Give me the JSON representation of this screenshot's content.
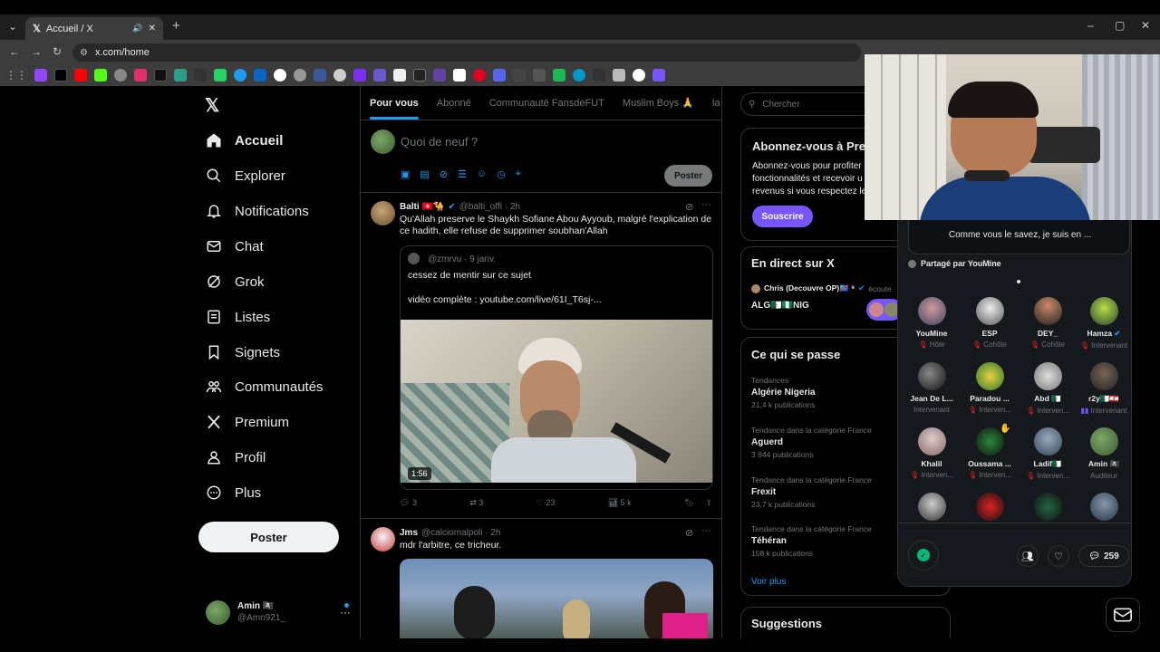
{
  "browser": {
    "tab_title": "Accueil / X",
    "url": "x.com/home"
  },
  "nav": {
    "items": [
      {
        "label": "Accueil",
        "icon": "home-icon"
      },
      {
        "label": "Explorer",
        "icon": "search-icon"
      },
      {
        "label": "Notifications",
        "icon": "bell-icon"
      },
      {
        "label": "Chat",
        "icon": "mail-icon"
      },
      {
        "label": "Grok",
        "icon": "grok-icon"
      },
      {
        "label": "Listes",
        "icon": "list-icon"
      },
      {
        "label": "Signets",
        "icon": "bookmark-icon"
      },
      {
        "label": "Communautés",
        "icon": "communities-icon"
      },
      {
        "label": "Premium",
        "icon": "x-logo-icon"
      },
      {
        "label": "Profil",
        "icon": "person-icon"
      },
      {
        "label": "Plus",
        "icon": "more-circle-icon"
      }
    ],
    "post_label": "Poster",
    "account_name": "Amin 🏴‍☠️",
    "account_handle": "@Amn921_"
  },
  "timeline": {
    "tabs": [
      "Pour vous",
      "Abonné",
      "Communauté FansdeFUT",
      "Muslim Boys 🙏",
      "la graill"
    ],
    "compose_placeholder": "Quoi de neuf ?",
    "compose_post_label": "Poster",
    "tweets": [
      {
        "author": "Balti 🇹🇳🐪",
        "handle": "@balti_offi · 2h",
        "text": "Qu'Allah preserve le Shaykh Sofiane Abou Ayyoub, malgré l'explication de ce hadith, elle refuse de supprimer soubhan'Allah",
        "quote_handle": "@zmrvu · 9 janv.",
        "quote_text_1": "cessez de mentir sur ce sujet",
        "quote_text_2": "vidéo complète : youtube.com/live/61I_T6sj-...",
        "video_duration": "1:56",
        "replies": "3",
        "reposts": "3",
        "likes": "23",
        "views": "5 k"
      },
      {
        "author": "Jms",
        "handle": "@calciomalpoli · 2h",
        "text": "mdr l'arbitre, ce tricheur."
      }
    ]
  },
  "right": {
    "search_placeholder": "Chercher",
    "premium": {
      "title": "Abonnez-vous à Pre",
      "text_1": "Abonnez-vous pour profiter",
      "text_2": "fonctionnalités et recevoir u",
      "text_3": "revenus si vous respectez les",
      "button": "Souscrire"
    },
    "live": {
      "title": "En direct sur X",
      "host": "Chris (Decouvre OP)🇨🇩 ⁹",
      "listening": "écoute",
      "topic": "ALG🇩🇿🇳🇬NIG"
    },
    "trends": {
      "title": "Ce qui se passe",
      "items": [
        {
          "context": "Tendances",
          "name": "Algérie Nigeria",
          "count": "21,4 k publications"
        },
        {
          "context": "Tendance dans la catégorie France",
          "name": "Aguerd",
          "count": "3 844 publications"
        },
        {
          "context": "Tendance dans la catégorie France",
          "name": "Frexit",
          "count": "23,7 k publications"
        },
        {
          "context": "Tendance dans la catégorie France",
          "name": "Téhéran",
          "count": "158 k publications"
        }
      ],
      "more": "Voir plus"
    },
    "suggestions_title": "Suggestions"
  },
  "spaces": {
    "pinned_text": "Comme vous le savez, je suis en ...",
    "shared_by": "Partagé par YouMine",
    "people": [
      {
        "name": "YouMine",
        "role": "Hôte"
      },
      {
        "name": "ESP",
        "role": "Cohôte"
      },
      {
        "name": "DEY_",
        "role": "Cohôte"
      },
      {
        "name": "Hamza",
        "role": "Intervenant"
      },
      {
        "name": "Jean De L...",
        "role": "Intervenant"
      },
      {
        "name": "Paradou ...",
        "role": "Interven..."
      },
      {
        "name": "Abd 🇩🇿",
        "role": "Interven..."
      },
      {
        "name": "r2y🇩🇿🇱🇧",
        "role": "Intervenant"
      },
      {
        "name": "Khalil",
        "role": "Interven..."
      },
      {
        "name": "Oussama ...",
        "role": "Interven..."
      },
      {
        "name": "Ladif🇩🇿",
        "role": "Interven..."
      },
      {
        "name": "Amin 🏴‍☠️",
        "role": "Auditeur"
      },
      {
        "name": "",
        "role": ""
      },
      {
        "name": "",
        "role": ""
      },
      {
        "name": "",
        "role": ""
      },
      {
        "name": "",
        "role": ""
      }
    ],
    "comment_count": "259"
  },
  "colors": {
    "accent": "#1d9bf0",
    "premium_button": "#7856ff",
    "mic_red": "#f4212e",
    "green": "#00ba7c"
  }
}
